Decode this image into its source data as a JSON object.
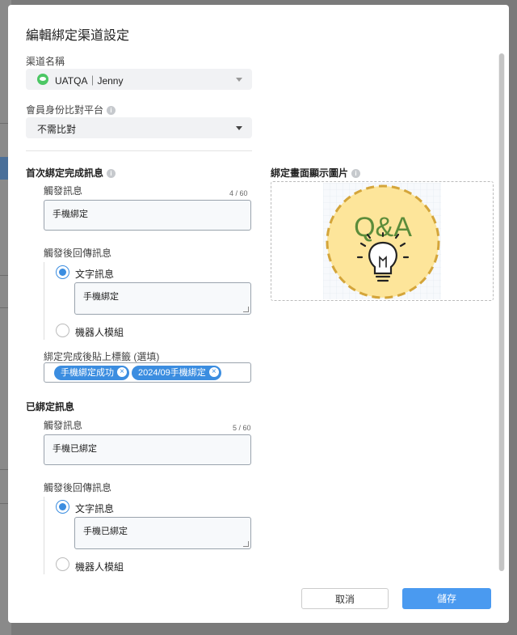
{
  "modal": {
    "title": "編輯綁定渠道設定"
  },
  "channel": {
    "label": "渠道名稱",
    "value": "UATQA｜Jenny"
  },
  "member_match": {
    "label": "會員身份比對平台",
    "value": "不需比對"
  },
  "first_bind": {
    "title": "首次綁定完成訊息",
    "trigger_label": "觸發訊息",
    "counter": "4 / 60",
    "trigger_value": "手機綁定",
    "reply_label": "觸發後回傳訊息",
    "option_text": "文字訊息",
    "reply_value": "手機綁定",
    "option_bot": "機器人模組",
    "tags_label": "綁定完成後貼上標籤 (選填)",
    "tags": [
      "手機綁定成功",
      "2024/09手機綁定"
    ]
  },
  "image": {
    "label": "綁定畫面顯示圖片",
    "qa_text": "Q&A"
  },
  "already_bound": {
    "title": "已綁定訊息",
    "trigger_label": "觸發訊息",
    "counter": "5 / 60",
    "trigger_value": "手機已綁定",
    "reply_label": "觸發後回傳訊息",
    "option_text": "文字訊息",
    "reply_value": "手機已綁定",
    "option_bot": "機器人模組"
  },
  "footer": {
    "cancel_label": "取消",
    "save_label": "儲存"
  },
  "colors": {
    "accent": "#3b8de0",
    "primary_button": "#4a9af0",
    "line_green": "#4cc764",
    "qa_yellow": "#fde59a",
    "qa_border": "#d4a53a",
    "qa_text": "#5b8c3a"
  }
}
